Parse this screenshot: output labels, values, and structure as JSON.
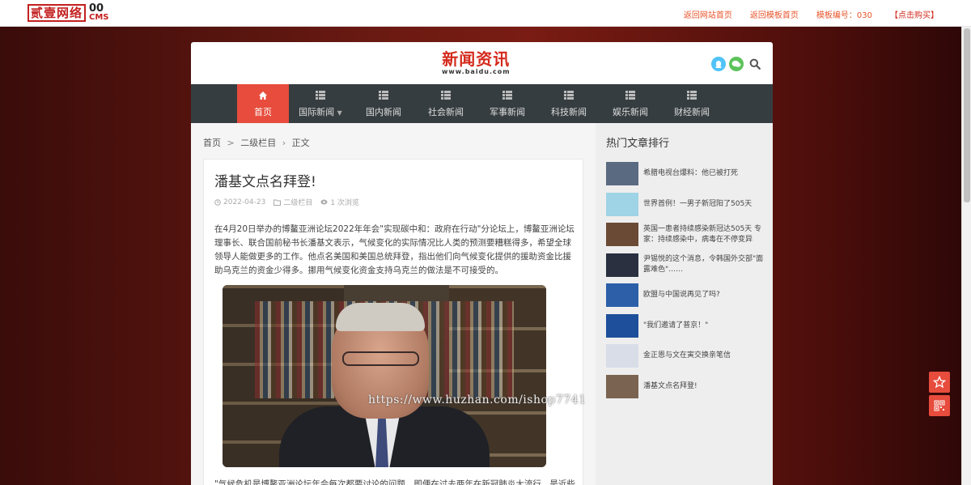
{
  "topbar": {
    "logo_main": "贰壹网络",
    "logo_num": "00",
    "logo_cms": "CMS",
    "links": [
      "返回网站首页",
      "返回模板首页",
      "模板编号：030",
      "【点击购买】"
    ]
  },
  "header": {
    "site_title": "新闻资讯",
    "site_url": "www.baidu.com"
  },
  "nav": {
    "items": [
      {
        "label": "首页",
        "icon": "home-icon",
        "active": true
      },
      {
        "label": "国际新闻",
        "icon": "list-icon",
        "dropdown": true
      },
      {
        "label": "国内新闻",
        "icon": "list-icon"
      },
      {
        "label": "社会新闻",
        "icon": "list-icon"
      },
      {
        "label": "军事新闻",
        "icon": "list-icon"
      },
      {
        "label": "科技新闻",
        "icon": "list-icon"
      },
      {
        "label": "娱乐新闻",
        "icon": "list-icon"
      },
      {
        "label": "财经新闻",
        "icon": "list-icon"
      }
    ]
  },
  "breadcrumb": {
    "home": "首页",
    "sep1": ">",
    "level2": "二级栏目",
    "sep2": "›",
    "current": "正文"
  },
  "article": {
    "title": "潘基文点名拜登!",
    "date": "2022-04-23",
    "category": "二级栏目",
    "views": "1 次浏览",
    "body": "在4月20日举办的博鳌亚洲论坛2022年年会\"实现碳中和：政府在行动\"分论坛上，博鳌亚洲论坛理事长、联合国前秘书长潘基文表示，气候变化的实际情况比人类的预测要糟糕得多，希望全球领导人能做更多的工作。他点名美国和美国总统拜登，指出他们向气候变化提供的援助资金比援助乌克兰的资金少得多。挪用气候变化资金支持乌克兰的做法是不可接受的。",
    "caption": "\"气候危机是博鳌亚洲论坛年会每次都要讨论的问题，即便在过去两年在新冠肺炎大流行，是近些"
  },
  "watermark": "https://www.huzhan.com/ishop7741",
  "sidebar": {
    "title": "热门文章排行",
    "items": [
      {
        "text": "希腊电视台爆料：他已被打死",
        "thumb_color": "#5a6a80"
      },
      {
        "text": "世界首例！一男子新冠阳了505天",
        "thumb_color": "#9fd3e6"
      },
      {
        "text": "英国一患者持续感染新冠达505天 专家：持续感染中，病毒在不停变异",
        "thumb_color": "#6b4a35"
      },
      {
        "text": "尹锡悦的这个消息，令韩国外交部\"面露难色\"……",
        "thumb_color": "#2a3040"
      },
      {
        "text": "欧盟与中国说再见了吗?",
        "thumb_color": "#2c5fa8"
      },
      {
        "text": "\"我们邀请了普京！\"",
        "thumb_color": "#1e4f9a"
      },
      {
        "text": "金正恩与文在寅交换亲笔信",
        "thumb_color": "#d8dde8"
      },
      {
        "text": "潘基文点名拜登!",
        "thumb_color": "#7a6350"
      }
    ]
  },
  "colors": {
    "accent": "#e74c3c",
    "nav_bg": "#363d40",
    "title_red": "#d42a1d"
  }
}
